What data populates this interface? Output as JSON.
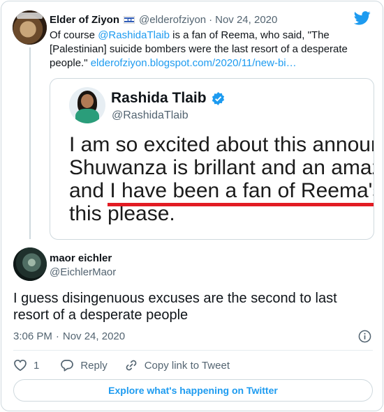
{
  "parent_tweet": {
    "name": "Elder of Ziyon",
    "handle": "@elderofziyon",
    "separator": "·",
    "date": "Nov 24, 2020",
    "text_before_mention": "Of course ",
    "mention": "@RashidaTlaib",
    "text_after_mention": " is a fan of Reema, who said, \"The [Palestinian] suicide bombers were the last resort of a desperate people.\" ",
    "link": "elderofziyon.blogspot.com/2020/11/new-bi…",
    "avatar_label": "ELDEROFZIYON",
    "flag_icon": "israel-flag-icon",
    "brand_icon": "twitter-bird-icon"
  },
  "quoted_tweet": {
    "name": "Rashida Tlaib",
    "handle": "@RashidaTlaib",
    "verified_icon": "verified-badge-icon",
    "image_text_lines": [
      "I am so excited about this announ",
      "Shuwanza is brillant and an amaz",
      "and I have been a fan of Reema's",
      "this please."
    ]
  },
  "reply_tweet": {
    "name": "maor eichler",
    "handle": "@EichlerMaor",
    "text": "I guess disingenuous excuses are the second to last resort of a desperate people",
    "time": "3:06 PM",
    "separator": "·",
    "date": "Nov 24, 2020",
    "info_icon": "info-icon"
  },
  "actions": {
    "like_count": "1",
    "reply_label": "Reply",
    "copy_link_label": "Copy link to Tweet"
  },
  "explore_button": {
    "label": "Explore what's happening on Twitter"
  },
  "colors": {
    "accent": "#1d9bf0",
    "text": "#0f1419",
    "secondary": "#536471",
    "border": "#cfd9de",
    "highlight_underline": "#e21b23"
  }
}
